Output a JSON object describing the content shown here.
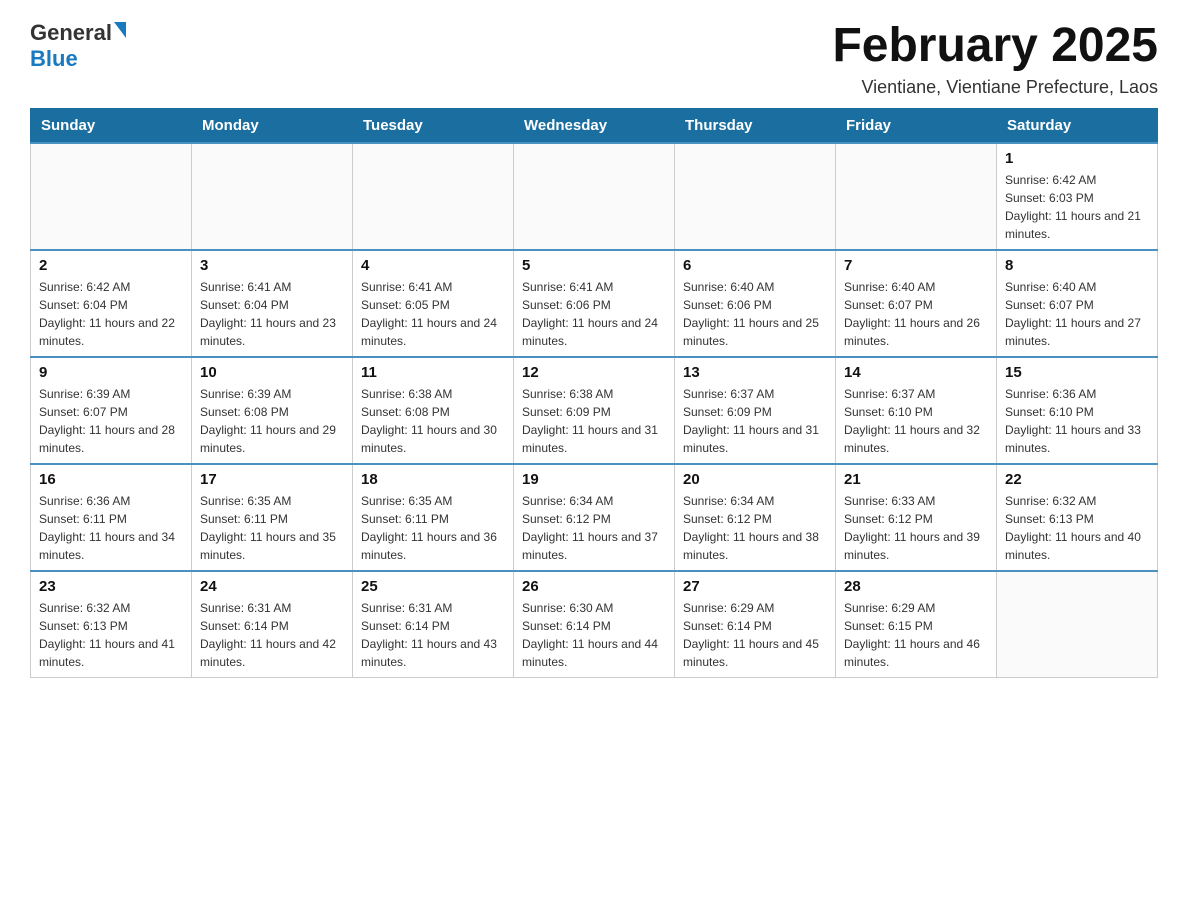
{
  "logo": {
    "general": "General",
    "blue": "Blue"
  },
  "title": "February 2025",
  "subtitle": "Vientiane, Vientiane Prefecture, Laos",
  "days_of_week": [
    "Sunday",
    "Monday",
    "Tuesday",
    "Wednesday",
    "Thursday",
    "Friday",
    "Saturday"
  ],
  "weeks": [
    [
      {
        "day": "",
        "info": ""
      },
      {
        "day": "",
        "info": ""
      },
      {
        "day": "",
        "info": ""
      },
      {
        "day": "",
        "info": ""
      },
      {
        "day": "",
        "info": ""
      },
      {
        "day": "",
        "info": ""
      },
      {
        "day": "1",
        "info": "Sunrise: 6:42 AM\nSunset: 6:03 PM\nDaylight: 11 hours and 21 minutes."
      }
    ],
    [
      {
        "day": "2",
        "info": "Sunrise: 6:42 AM\nSunset: 6:04 PM\nDaylight: 11 hours and 22 minutes."
      },
      {
        "day": "3",
        "info": "Sunrise: 6:41 AM\nSunset: 6:04 PM\nDaylight: 11 hours and 23 minutes."
      },
      {
        "day": "4",
        "info": "Sunrise: 6:41 AM\nSunset: 6:05 PM\nDaylight: 11 hours and 24 minutes."
      },
      {
        "day": "5",
        "info": "Sunrise: 6:41 AM\nSunset: 6:06 PM\nDaylight: 11 hours and 24 minutes."
      },
      {
        "day": "6",
        "info": "Sunrise: 6:40 AM\nSunset: 6:06 PM\nDaylight: 11 hours and 25 minutes."
      },
      {
        "day": "7",
        "info": "Sunrise: 6:40 AM\nSunset: 6:07 PM\nDaylight: 11 hours and 26 minutes."
      },
      {
        "day": "8",
        "info": "Sunrise: 6:40 AM\nSunset: 6:07 PM\nDaylight: 11 hours and 27 minutes."
      }
    ],
    [
      {
        "day": "9",
        "info": "Sunrise: 6:39 AM\nSunset: 6:07 PM\nDaylight: 11 hours and 28 minutes."
      },
      {
        "day": "10",
        "info": "Sunrise: 6:39 AM\nSunset: 6:08 PM\nDaylight: 11 hours and 29 minutes."
      },
      {
        "day": "11",
        "info": "Sunrise: 6:38 AM\nSunset: 6:08 PM\nDaylight: 11 hours and 30 minutes."
      },
      {
        "day": "12",
        "info": "Sunrise: 6:38 AM\nSunset: 6:09 PM\nDaylight: 11 hours and 31 minutes."
      },
      {
        "day": "13",
        "info": "Sunrise: 6:37 AM\nSunset: 6:09 PM\nDaylight: 11 hours and 31 minutes."
      },
      {
        "day": "14",
        "info": "Sunrise: 6:37 AM\nSunset: 6:10 PM\nDaylight: 11 hours and 32 minutes."
      },
      {
        "day": "15",
        "info": "Sunrise: 6:36 AM\nSunset: 6:10 PM\nDaylight: 11 hours and 33 minutes."
      }
    ],
    [
      {
        "day": "16",
        "info": "Sunrise: 6:36 AM\nSunset: 6:11 PM\nDaylight: 11 hours and 34 minutes."
      },
      {
        "day": "17",
        "info": "Sunrise: 6:35 AM\nSunset: 6:11 PM\nDaylight: 11 hours and 35 minutes."
      },
      {
        "day": "18",
        "info": "Sunrise: 6:35 AM\nSunset: 6:11 PM\nDaylight: 11 hours and 36 minutes."
      },
      {
        "day": "19",
        "info": "Sunrise: 6:34 AM\nSunset: 6:12 PM\nDaylight: 11 hours and 37 minutes."
      },
      {
        "day": "20",
        "info": "Sunrise: 6:34 AM\nSunset: 6:12 PM\nDaylight: 11 hours and 38 minutes."
      },
      {
        "day": "21",
        "info": "Sunrise: 6:33 AM\nSunset: 6:12 PM\nDaylight: 11 hours and 39 minutes."
      },
      {
        "day": "22",
        "info": "Sunrise: 6:32 AM\nSunset: 6:13 PM\nDaylight: 11 hours and 40 minutes."
      }
    ],
    [
      {
        "day": "23",
        "info": "Sunrise: 6:32 AM\nSunset: 6:13 PM\nDaylight: 11 hours and 41 minutes."
      },
      {
        "day": "24",
        "info": "Sunrise: 6:31 AM\nSunset: 6:14 PM\nDaylight: 11 hours and 42 minutes."
      },
      {
        "day": "25",
        "info": "Sunrise: 6:31 AM\nSunset: 6:14 PM\nDaylight: 11 hours and 43 minutes."
      },
      {
        "day": "26",
        "info": "Sunrise: 6:30 AM\nSunset: 6:14 PM\nDaylight: 11 hours and 44 minutes."
      },
      {
        "day": "27",
        "info": "Sunrise: 6:29 AM\nSunset: 6:14 PM\nDaylight: 11 hours and 45 minutes."
      },
      {
        "day": "28",
        "info": "Sunrise: 6:29 AM\nSunset: 6:15 PM\nDaylight: 11 hours and 46 minutes."
      },
      {
        "day": "",
        "info": ""
      }
    ]
  ]
}
